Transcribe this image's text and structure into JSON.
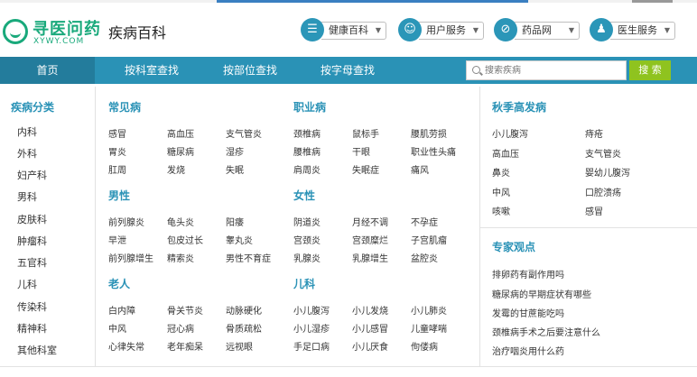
{
  "header": {
    "logo_cn": "寻医问药",
    "logo_en": "XYWY.COM",
    "site_title": "疾病百科",
    "buttons": [
      {
        "label": "健康百科",
        "icon": "menu-icon"
      },
      {
        "label": "用户服务",
        "icon": "user-icon"
      },
      {
        "label": "药品网",
        "icon": "pill-icon"
      },
      {
        "label": "医生服务",
        "icon": "doctor-icon"
      }
    ]
  },
  "nav": {
    "home": "首页",
    "items": [
      "按科室查找",
      "按部位查找",
      "按字母查找"
    ],
    "search_placeholder": "搜索疾病",
    "search_button": "搜 索"
  },
  "sidebar": {
    "title": "疾病分类",
    "items": [
      "内科",
      "外科",
      "妇产科",
      "男科",
      "皮肤科",
      "肿瘤科",
      "五官科",
      "儿科",
      "传染科",
      "精神科",
      "其他科室"
    ]
  },
  "sections": {
    "common": {
      "title": "常见病",
      "items": [
        "感冒",
        "高血压",
        "支气管炎",
        "胃炎",
        "糖尿病",
        "湿疹",
        "肛周",
        "发烧",
        "失眠"
      ]
    },
    "occupational": {
      "title": "职业病",
      "items": [
        "颈椎病",
        "鼠标手",
        "腰肌劳损",
        "腰椎病",
        "干眼",
        "职业性头痛",
        "肩周炎",
        "失眠症",
        "痛风"
      ]
    },
    "male": {
      "title": "男性",
      "items": [
        "前列腺炎",
        "龟头炎",
        "阳痿",
        "早泄",
        "包皮过长",
        "睾丸炎",
        "前列腺增生",
        "精索炎",
        "男性不育症"
      ]
    },
    "female": {
      "title": "女性",
      "items": [
        "阴道炎",
        "月经不调",
        "不孕症",
        "宫颈炎",
        "宫颈糜烂",
        "子宫肌瘤",
        "乳腺炎",
        "乳腺增生",
        "盆腔炎"
      ]
    },
    "elderly": {
      "title": "老人",
      "items": [
        "白内障",
        "骨关节炎",
        "动脉硬化",
        "中风",
        "冠心病",
        "骨质疏松",
        "心律失常",
        "老年痴呆",
        "远视眼"
      ]
    },
    "children": {
      "title": "儿科",
      "items": [
        "小儿腹泻",
        "小儿发烧",
        "小儿肺炎",
        "小儿湿疹",
        "小儿感冒",
        "儿童哮喘",
        "手足口病",
        "小儿厌食",
        "佝偻病"
      ]
    },
    "seasonal": {
      "title": "秋季高发病",
      "items": [
        "小儿腹泻",
        "痔疮",
        "高血压",
        "支气管炎",
        "鼻炎",
        "婴幼儿腹泻",
        "中风",
        "口腔溃疡",
        "咳嗽",
        "感冒"
      ]
    },
    "expert": {
      "title": "专家观点",
      "items": [
        "排卵药有副作用吗",
        "糖尿病的早期症状有哪些",
        "发霉的甘蔗能吃吗",
        "颈椎病手术之后要注意什么",
        "治疗咽炎用什么药"
      ]
    }
  },
  "colors": {
    "brand": "#19a97b",
    "nav": "#2a92b6",
    "nav_active": "#237c9c",
    "search_button": "#8fc31f",
    "section_title": "#2a92b6"
  }
}
